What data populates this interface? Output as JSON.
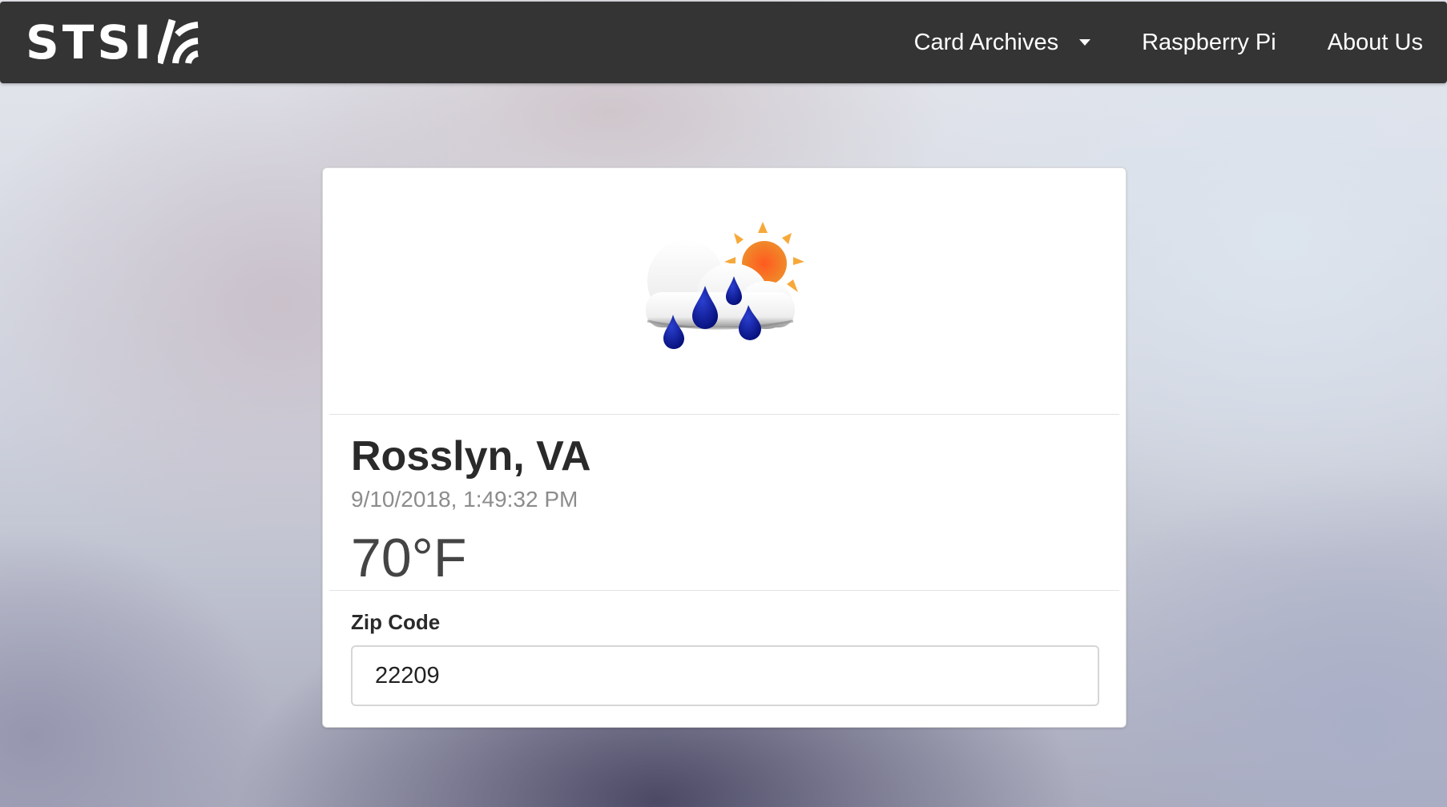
{
  "navbar": {
    "brand": "STSI",
    "links": [
      {
        "label": "Card Archives",
        "has_dropdown": true
      },
      {
        "label": "Raspberry Pi",
        "has_dropdown": false
      },
      {
        "label": "About Us",
        "has_dropdown": false
      }
    ]
  },
  "card": {
    "icon": "rain-showers-partly-sunny-icon",
    "location": "Rosslyn, VA",
    "timestamp": "9/10/2018, 1:49:32 PM",
    "temperature": "70°F",
    "zip": {
      "label": "Zip Code",
      "value": "22209"
    }
  },
  "colors": {
    "navbar_bg": "#343434",
    "card_bg": "#ffffff",
    "raindrop": "#0a1a9a",
    "sun": "#f26a2c",
    "sun_rays": "#f6a93a"
  }
}
